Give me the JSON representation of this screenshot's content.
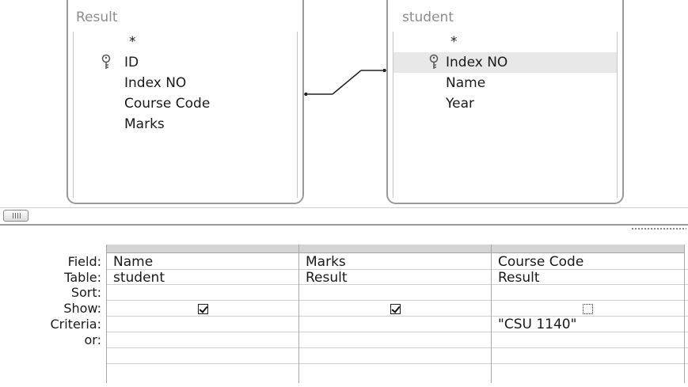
{
  "tables": [
    {
      "name": "Result",
      "fields": [
        "*",
        "ID",
        "Index NO",
        "Course Code",
        "Marks"
      ],
      "key_field": "ID"
    },
    {
      "name": "student",
      "fields": [
        "*",
        "Index NO",
        "Name",
        "Year"
      ],
      "key_field": "Index NO",
      "selected_field": "Index NO"
    }
  ],
  "join": {
    "from": "Result.Index NO",
    "to": "student.Index NO"
  },
  "grid": {
    "row_labels": [
      "Field:",
      "Table:",
      "Sort:",
      "Show:",
      "Criteria:",
      "or:"
    ],
    "columns": [
      {
        "field": "Name",
        "table": "student",
        "sort": "",
        "show": true,
        "criteria": "",
        "or": ""
      },
      {
        "field": "Marks",
        "table": "Result",
        "sort": "",
        "show": true,
        "criteria": "",
        "or": ""
      },
      {
        "field": "Course Code",
        "table": "Result",
        "sort": "",
        "show": false,
        "criteria": "\"CSU 1140\"",
        "or": ""
      }
    ]
  },
  "icons": {
    "key": "key-icon",
    "scroll": "scrollbar-thumb-icon"
  }
}
